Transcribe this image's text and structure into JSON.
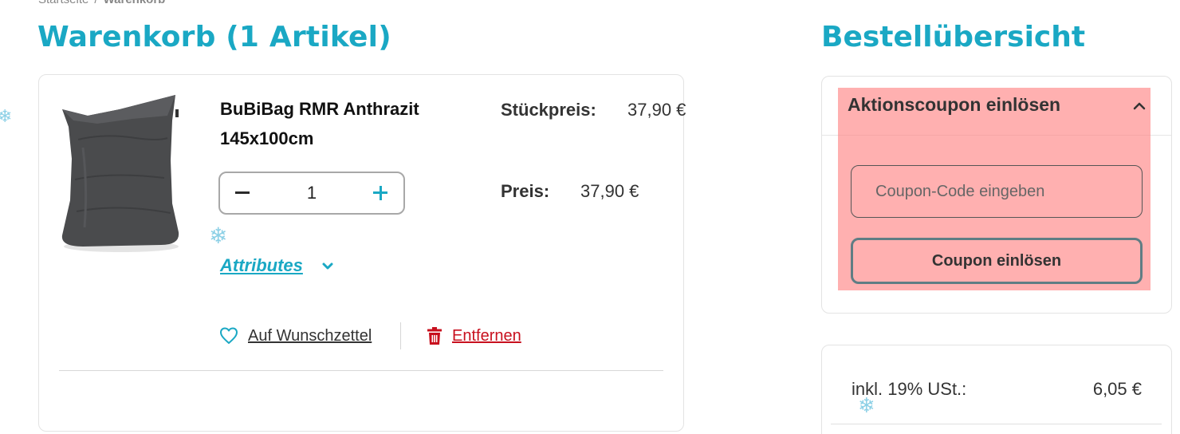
{
  "breadcrumb": {
    "home": "Startseite",
    "separator": "/",
    "current": "Warenkorb"
  },
  "cart": {
    "title": "Warenkorb (1 Artikel)",
    "item": {
      "name": "BuBiBag RMR Anthrazit 145x100cm",
      "quantity": "1",
      "unit_price_label": "Stückpreis:",
      "unit_price": "37,90 €",
      "price_label": "Preis:",
      "price": "37,90 €",
      "attributes_label": "Attributes",
      "wishlist_label": "Auf Wunschzettel",
      "remove_label": "Entfernen",
      "image_icon": "beanbag-product-image"
    }
  },
  "summary": {
    "title": "Bestellübersicht",
    "coupon": {
      "title": "Aktionscoupon einlösen",
      "placeholder": "Coupon-Code eingeben",
      "button_label": "Coupon einlösen",
      "highlight_color": "#ff8080"
    },
    "tax_label": "inkl. 19% USt.:",
    "tax_value": "6,05 €"
  },
  "colors": {
    "accent": "#1aa8c4",
    "danger": "#c8101e",
    "text": "#333333"
  },
  "decorations": {
    "snowflake": "❄"
  }
}
